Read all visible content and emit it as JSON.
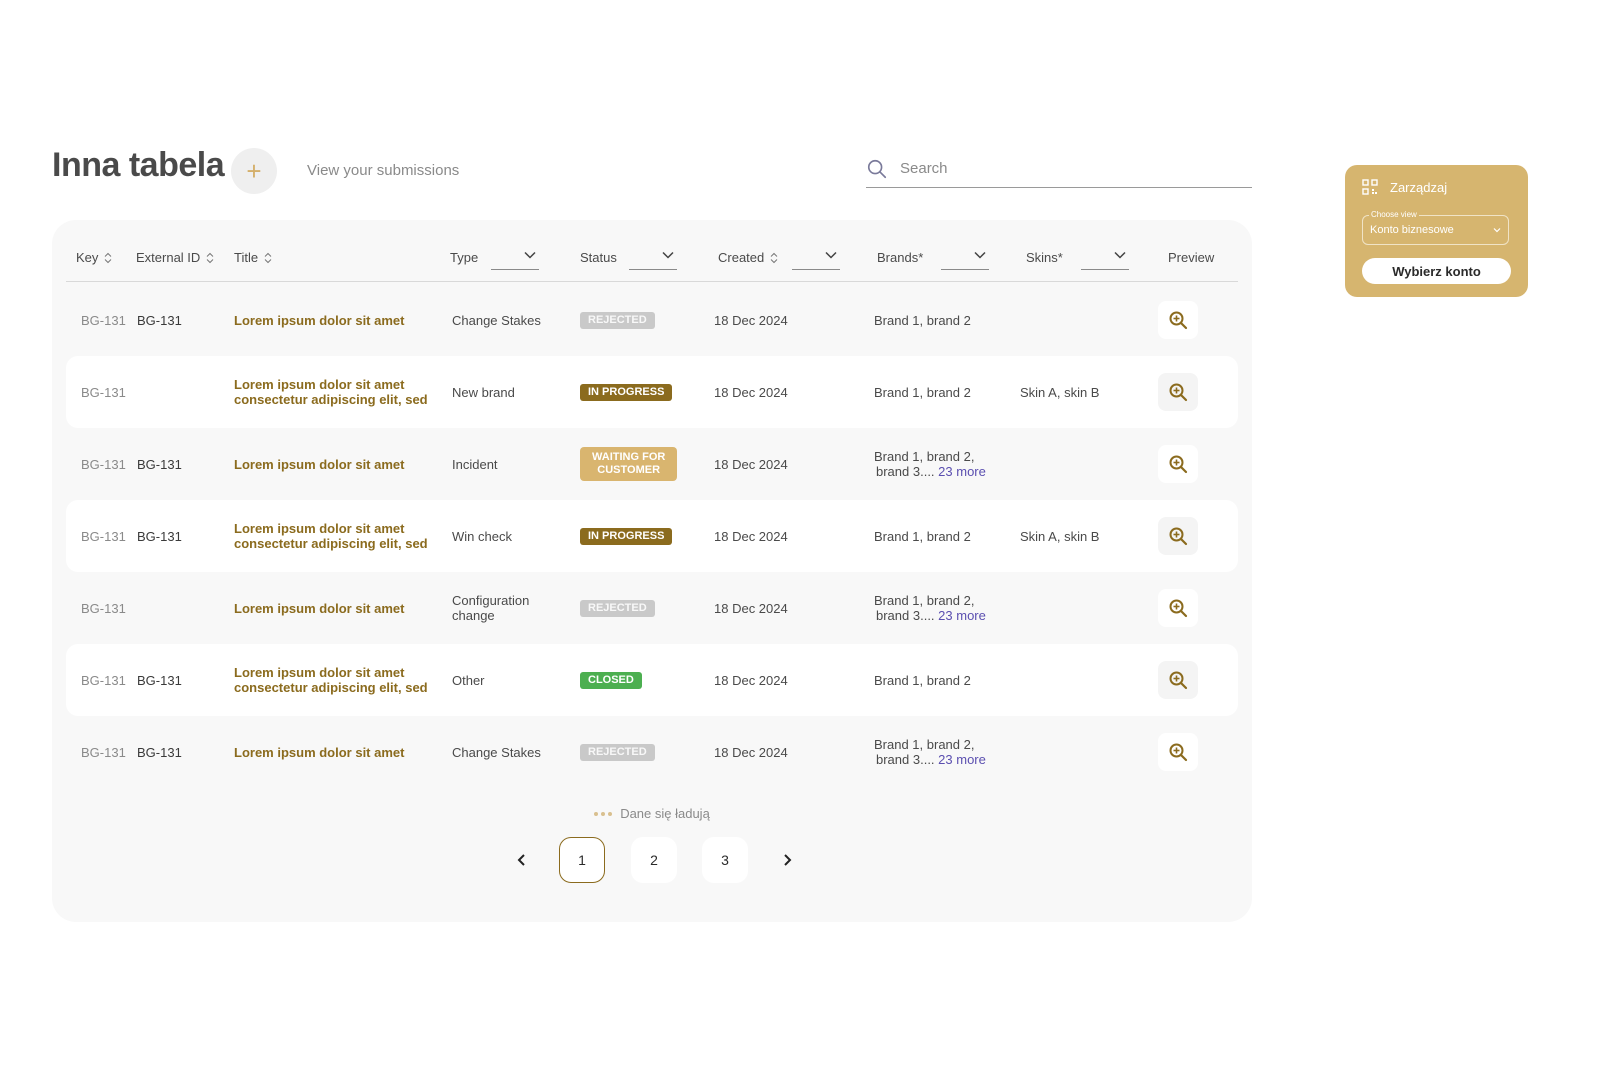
{
  "header": {
    "title": "Inna tabela",
    "add_icon": "plus-icon",
    "subtitle": "View your submissions"
  },
  "search": {
    "placeholder": "Search",
    "icon": "search-icon"
  },
  "table": {
    "columns": {
      "key": "Key",
      "external_id": "External ID",
      "title": "Title",
      "type": "Type",
      "status": "Status",
      "created": "Created",
      "brands": "Brands*",
      "skins": "Skins*",
      "preview": "Preview"
    },
    "rows": [
      {
        "key": "BG-131",
        "external_id": "BG-131",
        "title": [
          "Lorem ipsum dolor sit amet"
        ],
        "type": [
          "Change Stakes"
        ],
        "status": [
          "REJECTED"
        ],
        "status_kind": "rejected",
        "created": "18 Dec 2024",
        "brands": [
          "Brand 1, brand 2"
        ],
        "brands_more": "",
        "skins": ""
      },
      {
        "key": "BG-131",
        "external_id": "",
        "title": [
          "Lorem ipsum dolor sit amet",
          "consectetur adipiscing elit, sed"
        ],
        "type": [
          "New brand"
        ],
        "status": [
          "IN PROGRESS"
        ],
        "status_kind": "progress",
        "created": "18 Dec 2024",
        "brands": [
          "Brand 1, brand 2"
        ],
        "brands_more": "",
        "skins": "Skin A, skin B"
      },
      {
        "key": "BG-131",
        "external_id": "BG-131",
        "title": [
          "Lorem ipsum dolor sit amet"
        ],
        "type": [
          "Incident"
        ],
        "status": [
          "WAITING FOR",
          "CUSTOMER"
        ],
        "status_kind": "waiting",
        "created": "18 Dec 2024",
        "brands": [
          "Brand 1, brand 2,",
          "brand 3...."
        ],
        "brands_more": "23 more",
        "skins": ""
      },
      {
        "key": "BG-131",
        "external_id": "BG-131",
        "title": [
          "Lorem ipsum dolor sit amet",
          "consectetur adipiscing elit, sed"
        ],
        "type": [
          "Win check"
        ],
        "status": [
          "IN PROGRESS"
        ],
        "status_kind": "progress",
        "created": "18 Dec 2024",
        "brands": [
          "Brand 1, brand 2"
        ],
        "brands_more": "",
        "skins": "Skin A, skin B"
      },
      {
        "key": "BG-131",
        "external_id": "",
        "title": [
          "Lorem ipsum dolor sit amet"
        ],
        "type": [
          "Configuration",
          "change"
        ],
        "status": [
          "REJECTED"
        ],
        "status_kind": "rejected",
        "created": "18 Dec 2024",
        "brands": [
          "Brand 1, brand 2,",
          "brand 3...."
        ],
        "brands_more": "23 more",
        "skins": ""
      },
      {
        "key": "BG-131",
        "external_id": "BG-131",
        "title": [
          "Lorem ipsum dolor sit amet",
          "consectetur adipiscing elit, sed"
        ],
        "type": [
          "Other"
        ],
        "status": [
          "CLOSED"
        ],
        "status_kind": "closed",
        "created": "18 Dec 2024",
        "brands": [
          "Brand 1, brand 2"
        ],
        "brands_more": "",
        "skins": ""
      },
      {
        "key": "BG-131",
        "external_id": "BG-131",
        "title": [
          "Lorem ipsum dolor sit amet"
        ],
        "type": [
          "Change Stakes"
        ],
        "status": [
          "REJECTED"
        ],
        "status_kind": "rejected",
        "created": "18 Dec 2024",
        "brands": [
          "Brand 1, brand 2,",
          "brand 3...."
        ],
        "brands_more": "23 more",
        "skins": ""
      }
    ]
  },
  "loading_text": "Dane się ładują",
  "pagination": {
    "pages": [
      "1",
      "2",
      "3"
    ],
    "current": "1"
  },
  "widget": {
    "title": "Zarządzaj",
    "icon": "qr-grid-icon",
    "field_legend": "Choose view",
    "field_value": "Konto biznesowe",
    "button_label": "Wybierz konto"
  },
  "colors": {
    "accent": "#8b6b1e",
    "accent_light": "#d6b56f",
    "rejected": "#c9c9c9",
    "closed": "#4caf50",
    "link_more": "#5b4fb0"
  }
}
